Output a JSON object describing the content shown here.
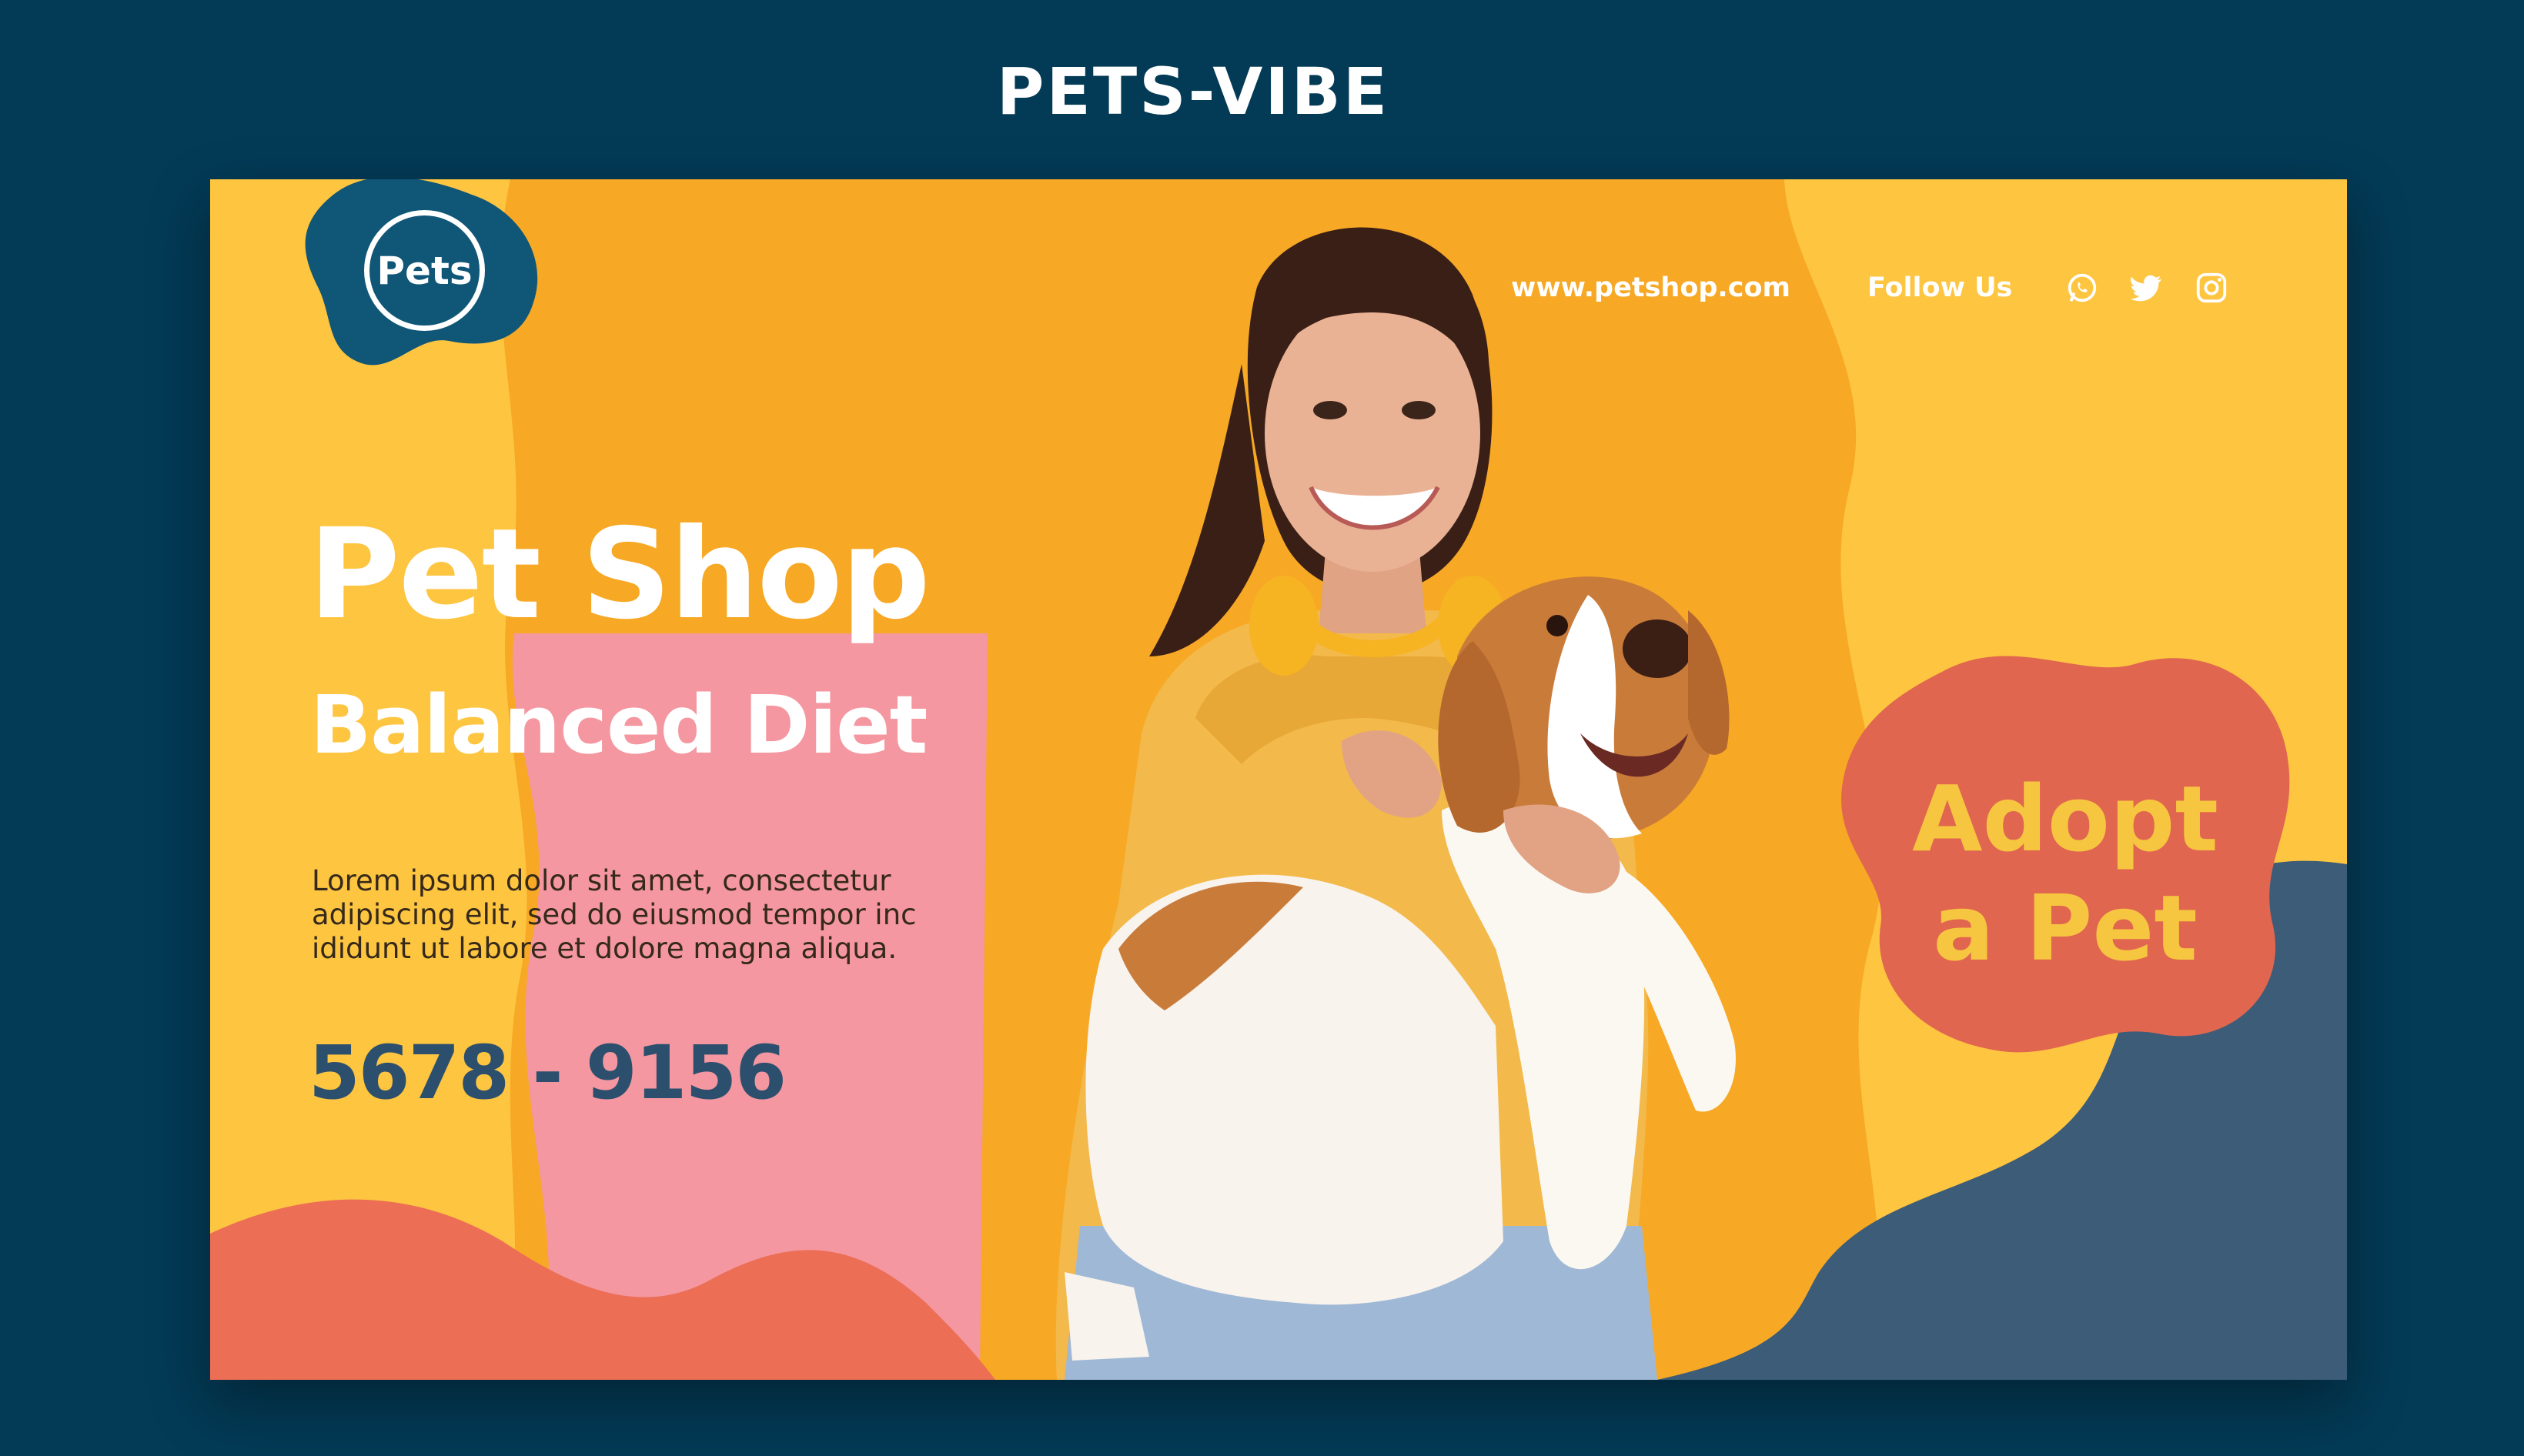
{
  "header": {
    "title": "PETS-VIBE"
  },
  "banner": {
    "logo_text": "Pets",
    "website": "www.petshop.com",
    "follow_label": "Follow Us",
    "social_icons": [
      "whatsapp-icon",
      "twitter-icon",
      "instagram-icon"
    ],
    "headline": "Pet Shop",
    "subheadline": "Balanced Diet",
    "body_lines": [
      "Lorem ipsum dolor sit amet, consectetur",
      "adipiscing elit, sed do eiusmod tempor inc",
      "ididunt ut labore et dolore magna aliqua."
    ],
    "phone": "5678 - 9156",
    "adopt_lines": [
      "Adopt",
      "a Pet"
    ]
  },
  "colors": {
    "page_bg": "#033a55",
    "banner_orange": "#f7a824",
    "banner_yellow": "#fec540",
    "pink": "#f497a0",
    "coral": "#ec6e55",
    "navy": "#3c5c78",
    "logo_blue": "#0f5677",
    "adopt_blob": "#e0664f",
    "adopt_text": "#f7c640",
    "phone_text": "#2d4f6e"
  }
}
